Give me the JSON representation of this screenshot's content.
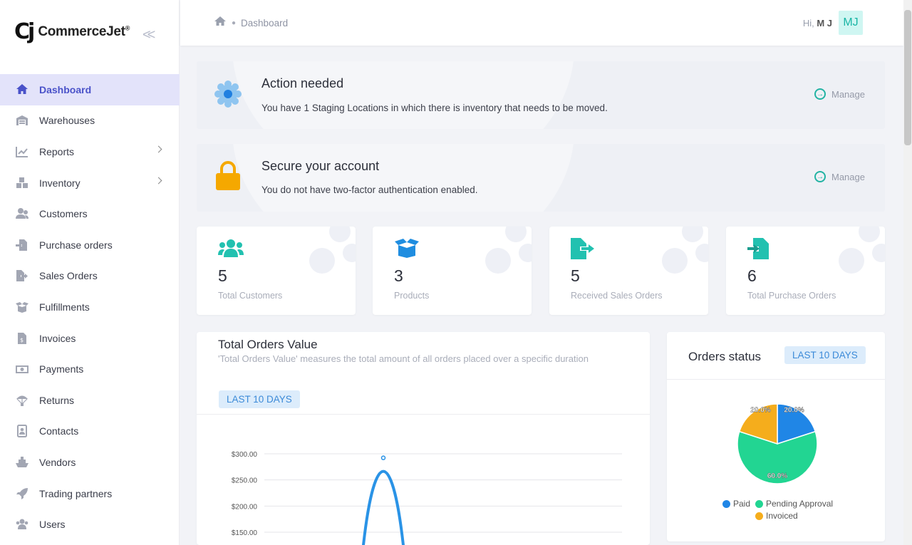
{
  "brand": {
    "mark": "Cj",
    "name": "CommerceJet",
    "mark_reg": "®"
  },
  "sidebar": {
    "items": [
      {
        "label": "Dashboard",
        "icon": "home-icon",
        "active": true,
        "has_children": false
      },
      {
        "label": "Warehouses",
        "icon": "warehouse-icon",
        "active": false,
        "has_children": false
      },
      {
        "label": "Reports",
        "icon": "chart-line-icon",
        "active": false,
        "has_children": true
      },
      {
        "label": "Inventory",
        "icon": "boxes-icon",
        "active": false,
        "has_children": true
      },
      {
        "label": "Customers",
        "icon": "user-group-icon",
        "active": false,
        "has_children": false
      },
      {
        "label": "Purchase orders",
        "icon": "file-import-icon",
        "active": false,
        "has_children": false
      },
      {
        "label": "Sales Orders",
        "icon": "file-export-icon",
        "active": false,
        "has_children": false
      },
      {
        "label": "Fulfillments",
        "icon": "box-open-icon",
        "active": false,
        "has_children": false
      },
      {
        "label": "Invoices",
        "icon": "invoice-icon",
        "active": false,
        "has_children": false
      },
      {
        "label": "Payments",
        "icon": "money-icon",
        "active": false,
        "has_children": false
      },
      {
        "label": "Returns",
        "icon": "parachute-icon",
        "active": false,
        "has_children": false
      },
      {
        "label": "Contacts",
        "icon": "contact-card-icon",
        "active": false,
        "has_children": false
      },
      {
        "label": "Vendors",
        "icon": "ship-icon",
        "active": false,
        "has_children": false
      },
      {
        "label": "Trading partners",
        "icon": "rocket-icon",
        "active": false,
        "has_children": false
      },
      {
        "label": "Users",
        "icon": "users-icon",
        "active": false,
        "has_children": false
      }
    ]
  },
  "header": {
    "breadcrumb": "Dashboard",
    "greeting_prefix": "Hi,",
    "user_name": "M J",
    "avatar_initials": "MJ"
  },
  "alerts": [
    {
      "title": "Action needed",
      "text": "You have 1 Staging Locations in which there is inventory that needs to be moved.",
      "action": "Manage",
      "icon": "gear-icon"
    },
    {
      "title": "Secure your account",
      "text": "You do not have two-factor authentication enabled.",
      "action": "Manage",
      "icon": "lock-icon"
    }
  ],
  "stats": [
    {
      "value": "5",
      "label": "Total Customers",
      "icon": "users-icon"
    },
    {
      "value": "3",
      "label": "Products",
      "icon": "box-open-icon"
    },
    {
      "value": "5",
      "label": "Received Sales Orders",
      "icon": "file-export-icon"
    },
    {
      "value": "6",
      "label": "Total Purchase Orders",
      "icon": "file-import-icon"
    }
  ],
  "orders_value": {
    "title": "Total Orders Value",
    "description": "'Total Orders Value' measures the total amount of all orders placed over a specific duration",
    "range_label": "LAST 10 DAYS"
  },
  "orders_status": {
    "title": "Orders status",
    "range_label": "LAST 10 DAYS"
  },
  "colors": {
    "accent_teal": "#22c1b0",
    "active_nav": "#4a52c9",
    "paid": "#2086e6",
    "pending": "#22d592",
    "invoiced": "#f5ad1c",
    "line": "#2a93e6"
  },
  "chart_data": [
    {
      "type": "line",
      "ylabel_format": "currency",
      "y_ticks": [
        "$300.00",
        "$250.00",
        "$200.00",
        "$150.00"
      ],
      "ylim": [
        150,
        300
      ],
      "grid": true,
      "series": [
        {
          "values": [
            {
              "x": 0,
              "y": 140
            },
            {
              "x": 1,
              "y": 295
            },
            {
              "x": 2,
              "y": 140
            }
          ]
        }
      ]
    },
    {
      "type": "pie",
      "legend": "bottom",
      "categories": [
        "Paid",
        "Pending Approval",
        "Invoiced"
      ],
      "values": [
        20,
        60,
        20
      ],
      "labels": [
        "20.0%",
        "60.0%",
        "20.0%"
      ]
    }
  ]
}
